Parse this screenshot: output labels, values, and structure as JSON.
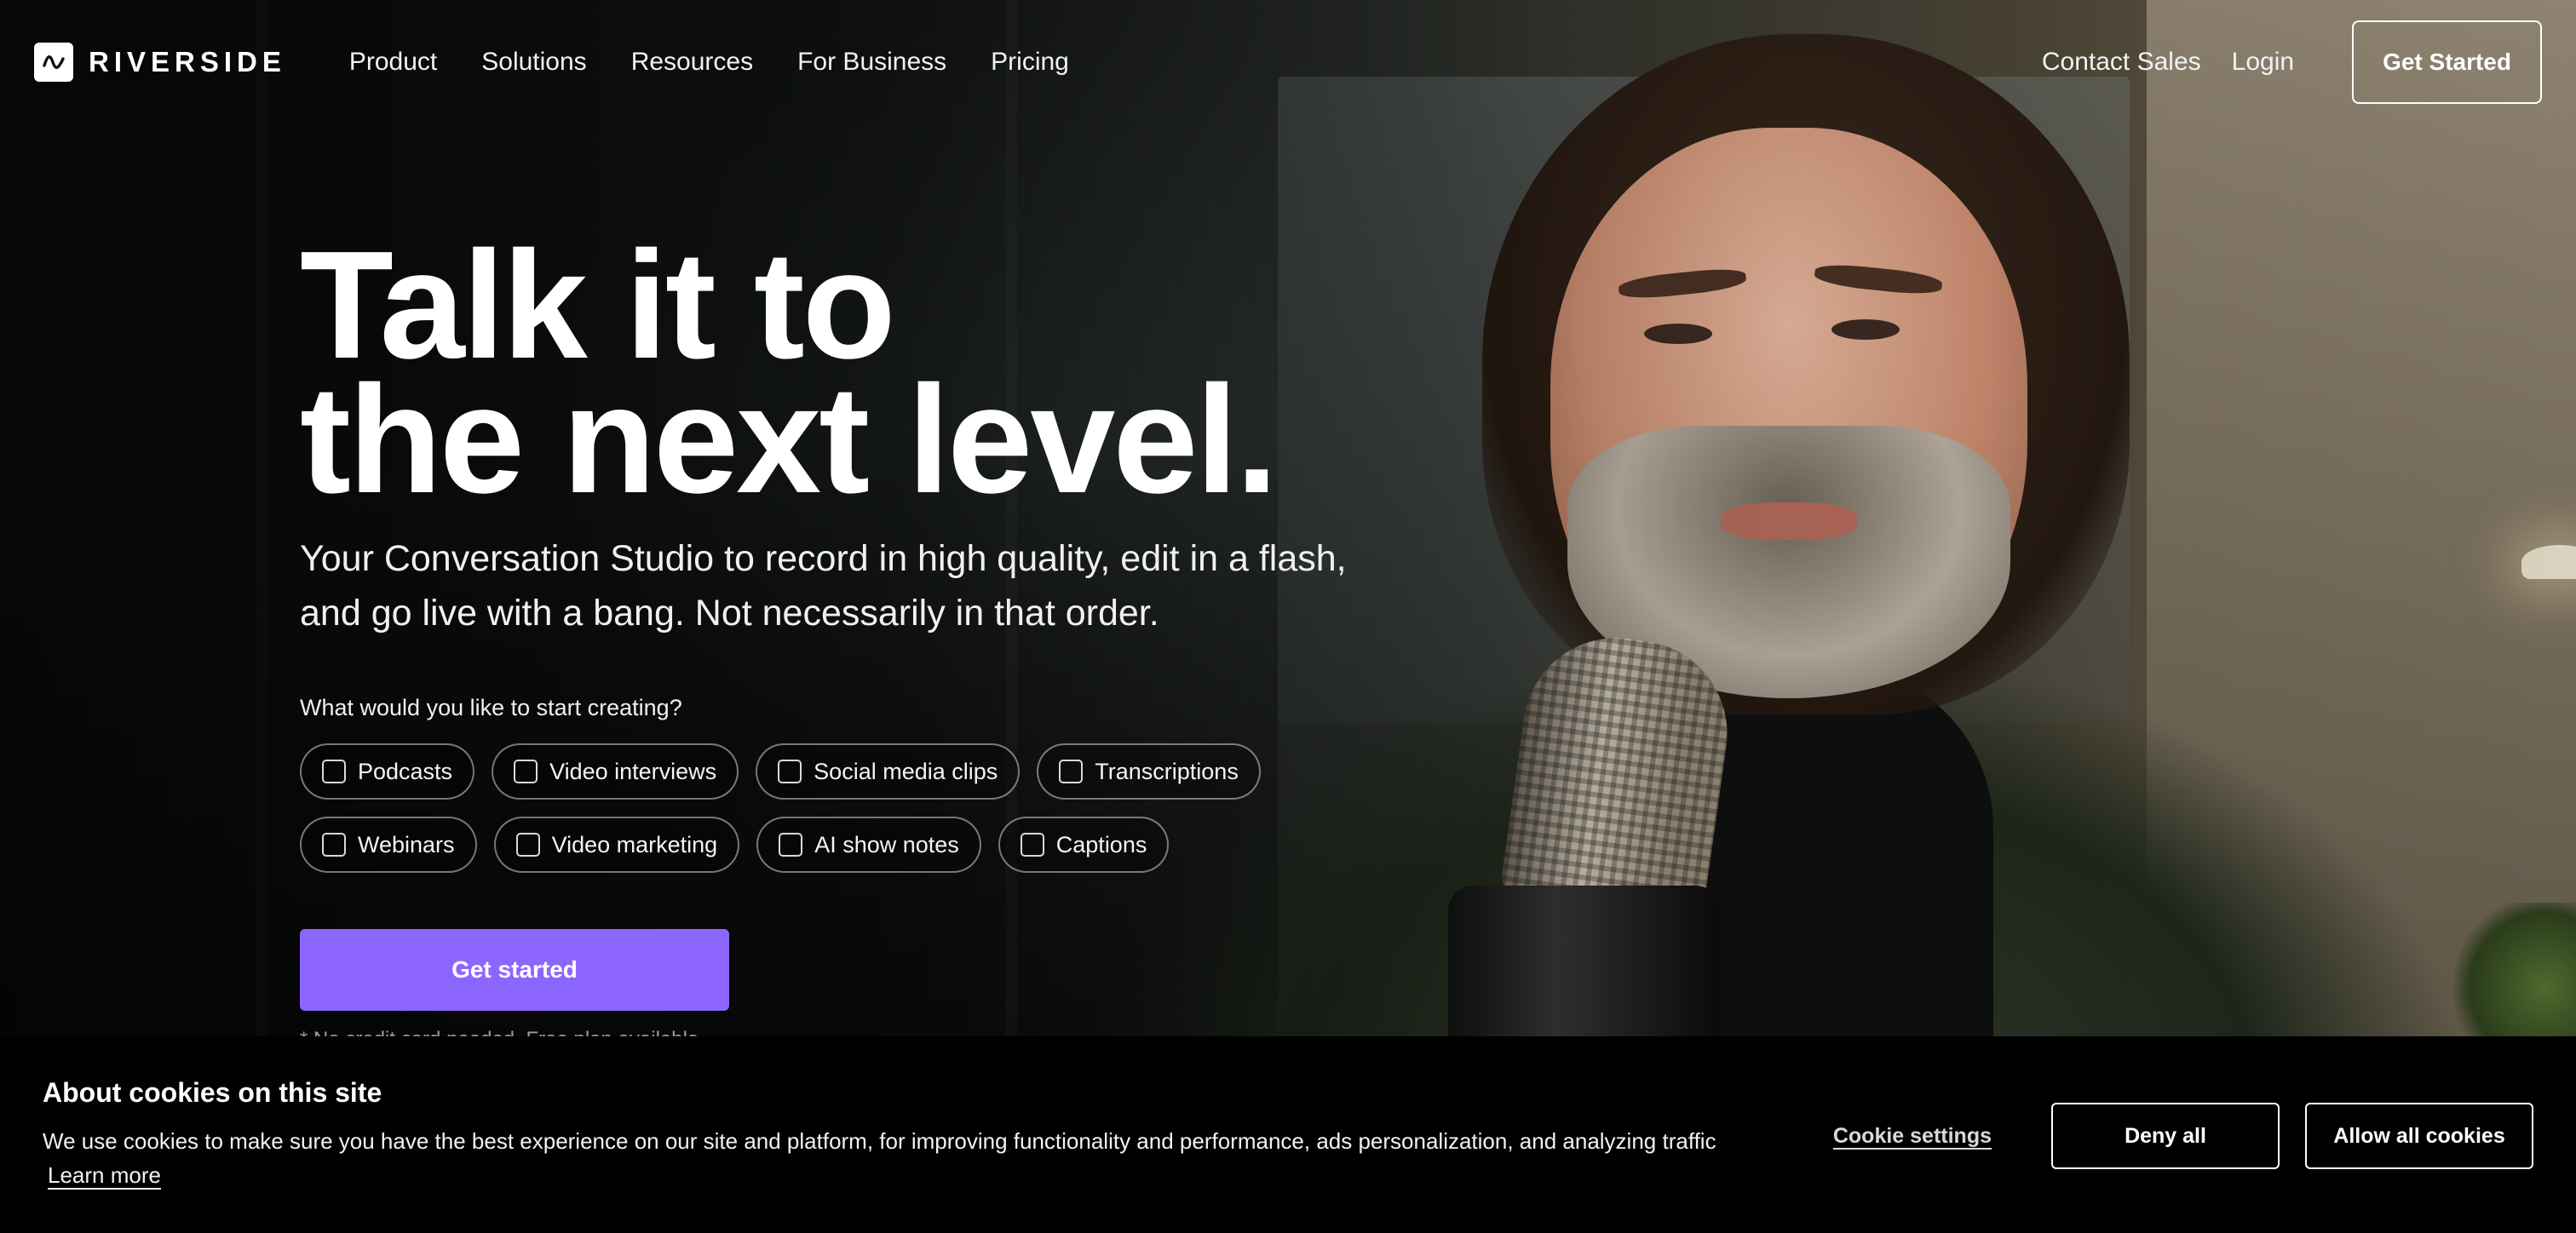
{
  "brand": {
    "name": "RIVERSIDE",
    "logo_icon": "waveform-icon"
  },
  "nav": {
    "links": [
      "Product",
      "Solutions",
      "Resources",
      "For Business",
      "Pricing"
    ],
    "contact_sales": "Contact Sales",
    "login": "Login",
    "get_started": "Get Started"
  },
  "hero": {
    "title_line1": "Talk it to",
    "title_line2": "the next level.",
    "subtitle": "Your Conversation Studio to record in high quality, edit in a flash, and go live with a bang. Not necessarily in that order.",
    "question": "What would you like to start creating?",
    "options_row1": [
      "Podcasts",
      "Video interviews",
      "Social media clips",
      "Transcriptions"
    ],
    "options_row2": [
      "Webinars",
      "Video marketing",
      "AI show notes",
      "Captions"
    ],
    "cta": "Get started",
    "note": "* No credit card needed. Free plan available."
  },
  "cookie_banner": {
    "title": "About cookies on this site",
    "text": "We use cookies to make sure you have the best experience on our site and platform, for improving functionality and performance, ads personalization, and analyzing traffic",
    "learn_more": "Learn more",
    "settings": "Cookie settings",
    "deny": "Deny all",
    "allow": "Allow all cookies"
  },
  "colors": {
    "accent": "#8c66ff",
    "banner_bg": "#000000"
  }
}
